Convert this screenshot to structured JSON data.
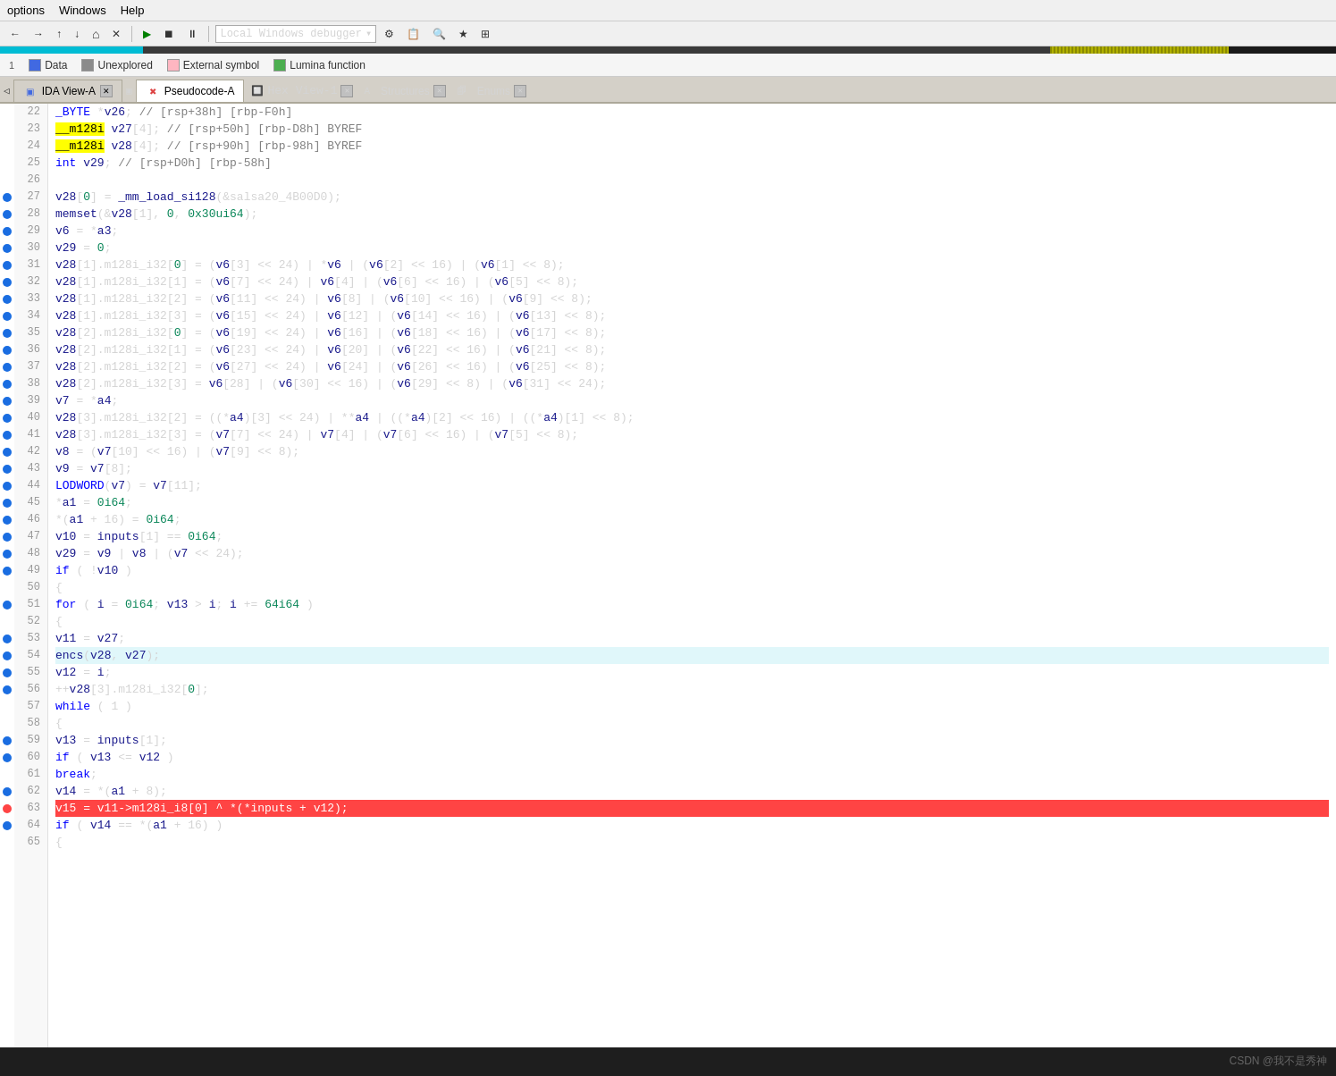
{
  "menubar": {
    "items": [
      "options",
      "Windows",
      "Help"
    ]
  },
  "toolbar": {
    "debugger_label": "Local Windows debugger",
    "buttons": [
      "←",
      "→",
      "↑",
      "↓",
      "≡",
      "✕",
      "▶",
      "⏹",
      "⏸"
    ]
  },
  "legend": {
    "items": [
      {
        "color": "blue",
        "label": "Data"
      },
      {
        "color": "gray",
        "label": "Unexplored"
      },
      {
        "color": "pink",
        "label": "External symbol"
      },
      {
        "color": "green",
        "label": "Lumina function"
      }
    ]
  },
  "tabs": [
    {
      "id": "ida-view-a",
      "label": "IDA View-A",
      "active": false,
      "closeable": true
    },
    {
      "id": "pseudocode-a",
      "label": "Pseudocode-A",
      "active": true,
      "closeable": true
    },
    {
      "id": "hex-view-1",
      "label": "Hex View-1",
      "active": false,
      "closeable": true
    },
    {
      "id": "structures",
      "label": "Structures",
      "active": false,
      "closeable": true
    },
    {
      "id": "enums",
      "label": "Enums",
      "active": false,
      "closeable": true
    }
  ],
  "code": {
    "lines": [
      {
        "num": 22,
        "bp": false,
        "text": "  _BYTE *v26; // [rsp+38h] [rbp-F0h]"
      },
      {
        "num": 23,
        "bp": false,
        "text": "  __m128i v27[4]; // [rsp+50h] [rbp-D8h] BYREF",
        "highlight": "yellow_word"
      },
      {
        "num": 24,
        "bp": false,
        "text": "  __m128i v28[4]; // [rsp+90h] [rbp-98h] BYREF",
        "highlight": "yellow_word"
      },
      {
        "num": 25,
        "bp": false,
        "text": "  int v29; // [rsp+D0h] [rbp-58h]"
      },
      {
        "num": 26,
        "bp": false,
        "text": ""
      },
      {
        "num": 27,
        "bp": true,
        "text": "  v28[0] = _mm_load_si128(&salsa20_4B00D0);"
      },
      {
        "num": 28,
        "bp": true,
        "text": "  memset(&v28[1], 0, 0x30ui64);"
      },
      {
        "num": 29,
        "bp": true,
        "text": "  v6 = *a3;"
      },
      {
        "num": 30,
        "bp": true,
        "text": "  v29 = 0;"
      },
      {
        "num": 31,
        "bp": true,
        "text": "  v28[1].m128i_i32[0] = (v6[3] << 24) | *v6 | (v6[2] << 16) | (v6[1] << 8);"
      },
      {
        "num": 32,
        "bp": true,
        "text": "  v28[1].m128i_i32[1] = (v6[7] << 24) | v6[4] | (v6[6] << 16) | (v6[5] << 8);"
      },
      {
        "num": 33,
        "bp": true,
        "text": "  v28[1].m128i_i32[2] = (v6[11] << 24) | v6[8] | (v6[10] << 16) | (v6[9] << 8);"
      },
      {
        "num": 34,
        "bp": true,
        "text": "  v28[1].m128i_i32[3] = (v6[15] << 24) | v6[12] | (v6[14] << 16) | (v6[13] << 8);"
      },
      {
        "num": 35,
        "bp": true,
        "text": "  v28[2].m128i_i32[0] = (v6[19] << 24) | v6[16] | (v6[18] << 16) | (v6[17] << 8);"
      },
      {
        "num": 36,
        "bp": true,
        "text": "  v28[2].m128i_i32[1] = (v6[23] << 24) | v6[20] | (v6[22] << 16) | (v6[21] << 8);"
      },
      {
        "num": 37,
        "bp": true,
        "text": "  v28[2].m128i_i32[2] = (v6[27] << 24) | v6[24] | (v6[26] << 16) | (v6[25] << 8);"
      },
      {
        "num": 38,
        "bp": true,
        "text": "  v28[2].m128i_i32[3] = v6[28] | (v6[30] << 16) | (v6[29] << 8) | (v6[31] << 24);"
      },
      {
        "num": 39,
        "bp": true,
        "text": "  v7 = *a4;"
      },
      {
        "num": 40,
        "bp": true,
        "text": "  v28[3].m128i_i32[2] = ((*a4)[3] << 24) | **a4 | ((*a4)[2] << 16) | ((*a4)[1] << 8);"
      },
      {
        "num": 41,
        "bp": true,
        "text": "  v28[3].m128i_i32[3] = (v7[7] << 24) | v7[4] | (v7[6] << 16) | (v7[5] << 8);"
      },
      {
        "num": 42,
        "bp": true,
        "text": "  v8 = (v7[10] << 16) | (v7[9] << 8);"
      },
      {
        "num": 43,
        "bp": true,
        "text": "  v9 = v7[8];"
      },
      {
        "num": 44,
        "bp": true,
        "text": "  LODWORD(v7) = v7[11];"
      },
      {
        "num": 45,
        "bp": true,
        "text": "  *a1 = 0i64;"
      },
      {
        "num": 46,
        "bp": true,
        "text": "  *(a1 + 16) = 0i64;"
      },
      {
        "num": 47,
        "bp": true,
        "text": "  v10 = inputs[1] == 0i64;"
      },
      {
        "num": 48,
        "bp": true,
        "text": "  v29 = v9 | v8 | (v7 << 24);"
      },
      {
        "num": 49,
        "bp": true,
        "text": "  if ( !v10 )"
      },
      {
        "num": 50,
        "bp": false,
        "text": "  {"
      },
      {
        "num": 51,
        "bp": true,
        "text": "    for ( i = 0i64; v13 > i; i += 64i64 )"
      },
      {
        "num": 52,
        "bp": false,
        "text": "    {"
      },
      {
        "num": 53,
        "bp": true,
        "text": "      v11 = v27;"
      },
      {
        "num": 54,
        "bp": true,
        "text": "      encs(v28, v27);",
        "highlight": "cyan"
      },
      {
        "num": 55,
        "bp": true,
        "text": "      v12 = i;"
      },
      {
        "num": 56,
        "bp": true,
        "text": "    ++v28[3].m128i_i32[0];"
      },
      {
        "num": 57,
        "bp": false,
        "text": "    while ( 1 )"
      },
      {
        "num": 58,
        "bp": false,
        "text": "    {"
      },
      {
        "num": 59,
        "bp": true,
        "text": "      v13 = inputs[1];"
      },
      {
        "num": 60,
        "bp": true,
        "text": "      if ( v13 <= v12 )"
      },
      {
        "num": 61,
        "bp": false,
        "text": "        break;"
      },
      {
        "num": 62,
        "bp": true,
        "text": "      v14 = *(a1 + 8);"
      },
      {
        "num": 63,
        "bp": true,
        "text": "      v15 = v11->m128i_i8[0] ^ *(*inputs + v12);",
        "highlight": "red"
      },
      {
        "num": 64,
        "bp": true,
        "text": "      if ( v14 == *(a1 + 16) )"
      },
      {
        "num": 65,
        "bp": false,
        "text": "      {"
      }
    ]
  },
  "watermark": "CSDN @我不是秀神"
}
